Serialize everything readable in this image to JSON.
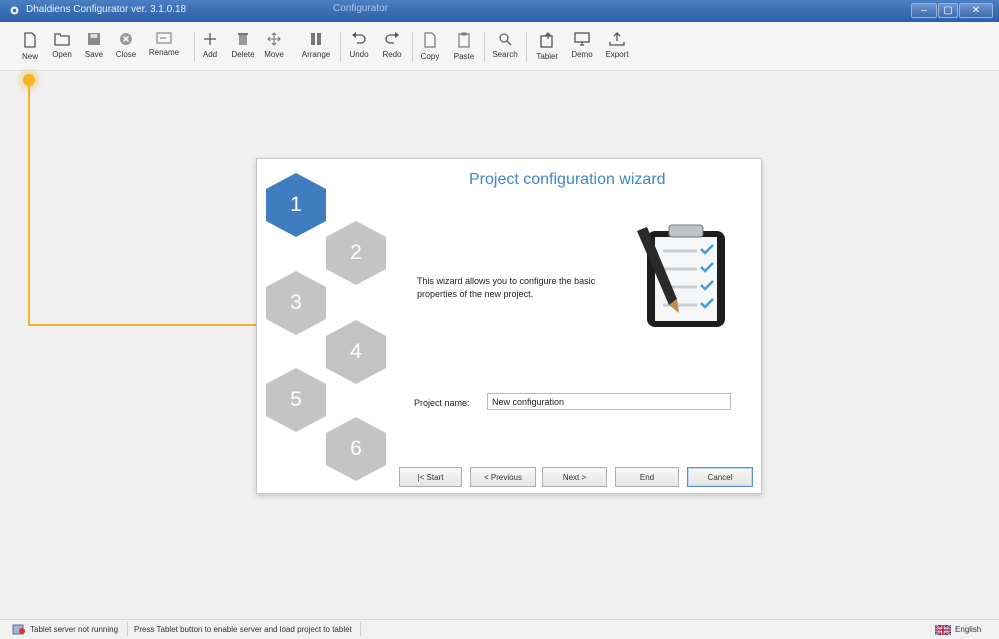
{
  "window": {
    "title": "Dhaldiens Configurator ver. 3.1.0.18",
    "center_title": "Configurator"
  },
  "toolbar": {
    "items": [
      {
        "label": "New",
        "icon": "new-document-icon"
      },
      {
        "label": "Open",
        "icon": "folder-icon"
      },
      {
        "label": "Save",
        "icon": "floppy-icon"
      },
      {
        "label": "Close",
        "icon": "close-circle-icon"
      },
      {
        "label": "Rename",
        "icon": "rename-icon"
      },
      {
        "label": "Add",
        "icon": "plus-icon"
      },
      {
        "label": "Delete",
        "icon": "trash-icon"
      },
      {
        "label": "Move",
        "icon": "move-icon"
      },
      {
        "label": "Arrange",
        "icon": "arrange-icon"
      },
      {
        "label": "Undo",
        "icon": "undo-icon"
      },
      {
        "label": "Redo",
        "icon": "redo-icon"
      },
      {
        "label": "Copy",
        "icon": "copy-icon"
      },
      {
        "label": "Paste",
        "icon": "paste-icon"
      },
      {
        "label": "Search",
        "icon": "search-icon"
      },
      {
        "label": "Tablet",
        "icon": "tablet-icon"
      },
      {
        "label": "Demo",
        "icon": "monitor-icon"
      },
      {
        "label": "Export",
        "icon": "export-icon"
      }
    ]
  },
  "wizard": {
    "title": "Project configuration wizard",
    "steps": [
      "1",
      "2",
      "3",
      "4",
      "5",
      "6"
    ],
    "active_step": 1,
    "description": "This wizard allows you to configure the basic properties of the new project.",
    "project_name_label": "Project name:",
    "project_name_value": "New configuration",
    "buttons": {
      "start": "|< Start",
      "previous": "< Previous",
      "next": "Next >",
      "end": "End",
      "cancel": "Cancel"
    }
  },
  "status": {
    "server": "Tablet server not running",
    "hint": "Press Tablet button to enable server and load project to tablet",
    "language": "English"
  },
  "colors": {
    "accent": "#3d87cc",
    "active_hex": "#3f7cc0",
    "inactive_hex": "#c4c4c4",
    "callout": "#f3b428",
    "titlebar": "#2b5fa6"
  }
}
